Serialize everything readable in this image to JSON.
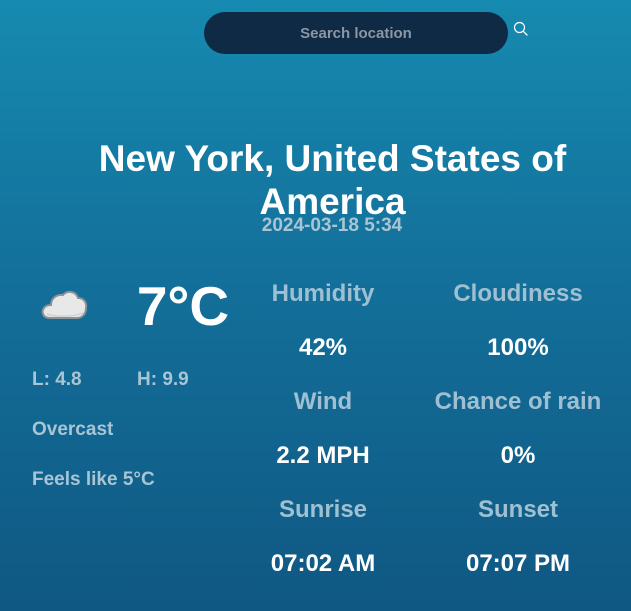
{
  "search": {
    "placeholder": "Search location",
    "value": ""
  },
  "location": {
    "name": "New York, United States of America",
    "datetime": "2024-03-18 5:34"
  },
  "current": {
    "icon": "cloud-icon",
    "temperature": "7°C",
    "low": "L: 4.8",
    "high": "H: 9.9",
    "condition": "Overcast",
    "feels_like": "Feels like 5°C"
  },
  "metrics": {
    "humidity_label": "Humidity",
    "humidity_value": "42%",
    "cloudiness_label": "Cloudiness",
    "cloudiness_value": "100%",
    "wind_label": "Wind",
    "wind_value": "2.2 MPH",
    "rain_label": "Chance of rain",
    "rain_value": "0%",
    "sunrise_label": "Sunrise",
    "sunrise_value": "07:02 AM",
    "sunset_label": "Sunset",
    "sunset_value": "07:07 PM"
  },
  "colors": {
    "background_top": "#168ab0",
    "background_bottom": "#0f5883",
    "search_bar": "#0e2a45",
    "muted_text": "#a9c5d4"
  }
}
